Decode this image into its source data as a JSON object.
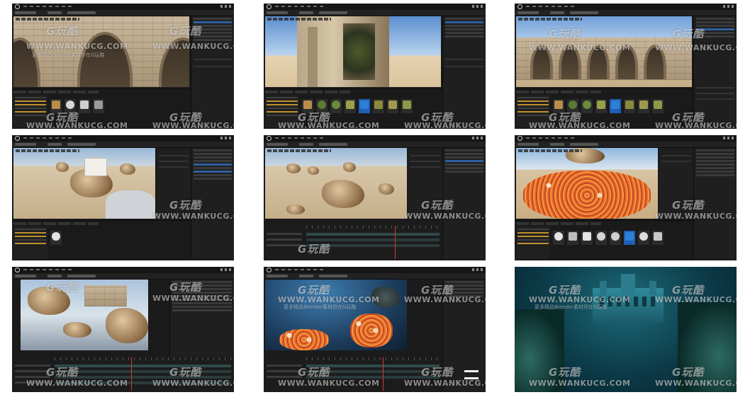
{
  "watermark": {
    "logo": "G玩酷",
    "url": "WWW.WANKUCG.COM",
    "tagline": "更多精品Blender素材尽在G玩酷"
  },
  "tiles": [
    {
      "name": "tile-1-gothic-arches",
      "scene": "gothic-wall-arches",
      "layout": "content-browser"
    },
    {
      "name": "tile-2-ruined-facade",
      "scene": "ruin-on-beach",
      "layout": "content-browser"
    },
    {
      "name": "tile-3-ruins-wall",
      "scene": "ruins-wall-sky",
      "layout": "content-browser"
    },
    {
      "name": "tile-4-floating-rocks",
      "scene": "desert-floating-rocks",
      "layout": "content-browser"
    },
    {
      "name": "tile-5-rock-cluster",
      "scene": "desert-rock-cluster",
      "layout": "sequencer"
    },
    {
      "name": "tile-6-coral-field",
      "scene": "coral-field",
      "layout": "content-browser"
    },
    {
      "name": "tile-7-floating-island",
      "scene": "sky-island",
      "layout": "sequencer"
    },
    {
      "name": "tile-8-underwater",
      "scene": "underwater-coral",
      "layout": "sequencer"
    },
    {
      "name": "tile-9-sunken-castle",
      "scene": "sunken-castle-render",
      "layout": "render"
    }
  ],
  "colors": {
    "editor_bg": "#1b1b1b",
    "panel": "#1f1f1f",
    "selection": "#1f5fb5",
    "playhead": "#d63a3a",
    "folder": "#c09030"
  }
}
